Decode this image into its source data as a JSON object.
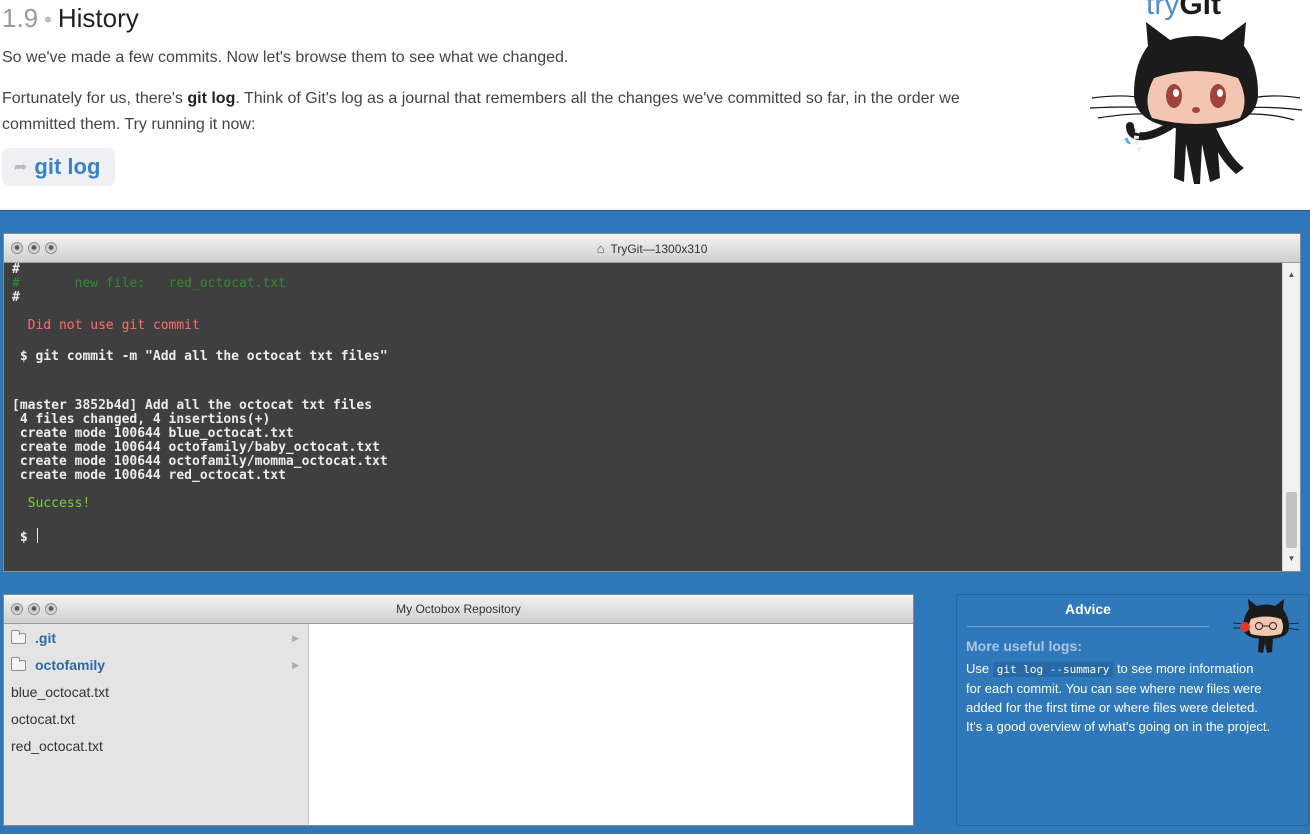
{
  "lesson": {
    "number": "1.9",
    "separator": "•",
    "title": "History",
    "p1": "So we've made a few commits. Now let's browse them to see what we changed.",
    "p2_before": "Fortunately for us, there's ",
    "p2_bold": "git log",
    "p2_after": ". Think of Git's log as a journal that remembers all the changes we've committed so far, in the order we committed them. Try running it now:",
    "command_button": "git log",
    "command_icon": "share-arrow"
  },
  "logo": {
    "try": "try",
    "git": "Git"
  },
  "terminal": {
    "title": "TryGit—1300x310",
    "lines": [
      {
        "text": "#       new file:   red_octocat.txt",
        "style": "dimgreen"
      },
      {
        "text": "#",
        "style": "bold"
      },
      {
        "text": "  Did not use git commit",
        "style": "red"
      },
      {
        "text": " $ git commit -m \"Add all the octocat txt files\"",
        "style": "bold"
      },
      {
        "text": "[master 3852b4d] Add all the octocat txt files",
        "style": "bold"
      },
      {
        "text": " 4 files changed, 4 insertions(+)",
        "style": "bold"
      },
      {
        "text": " create mode 100644 blue_octocat.txt",
        "style": "bold"
      },
      {
        "text": " create mode 100644 octofamily/baby_octocat.txt",
        "style": "bold"
      },
      {
        "text": " create mode 100644 octofamily/momma_octocat.txt",
        "style": "bold"
      },
      {
        "text": " create mode 100644 red_octocat.txt",
        "style": "bold"
      },
      {
        "text": "  Success!",
        "style": "green"
      },
      {
        "text": " $ ",
        "style": "bold"
      }
    ],
    "top_partial_line": "#"
  },
  "repo": {
    "title": "My Octobox Repository",
    "items": [
      {
        "name": ".git",
        "type": "folder"
      },
      {
        "name": "octofamily",
        "type": "folder"
      },
      {
        "name": "blue_octocat.txt",
        "type": "file"
      },
      {
        "name": "octocat.txt",
        "type": "file"
      },
      {
        "name": "red_octocat.txt",
        "type": "file"
      }
    ]
  },
  "advice": {
    "title": "Advice",
    "subtitle": "More useful logs:",
    "text_before": "Use ",
    "code": "git log --summary",
    "text_after": " to see more information for each commit. You can see where new files were added for the first time or where files were deleted. It's a good overview of what's going on in the project."
  },
  "colors": {
    "workspace_blue": "#2e77b8",
    "terminal_bg": "#3f3f3f",
    "link_blue": "#3a82c3",
    "success_green": "#7ad03a",
    "error_red": "#ff6d6d"
  }
}
